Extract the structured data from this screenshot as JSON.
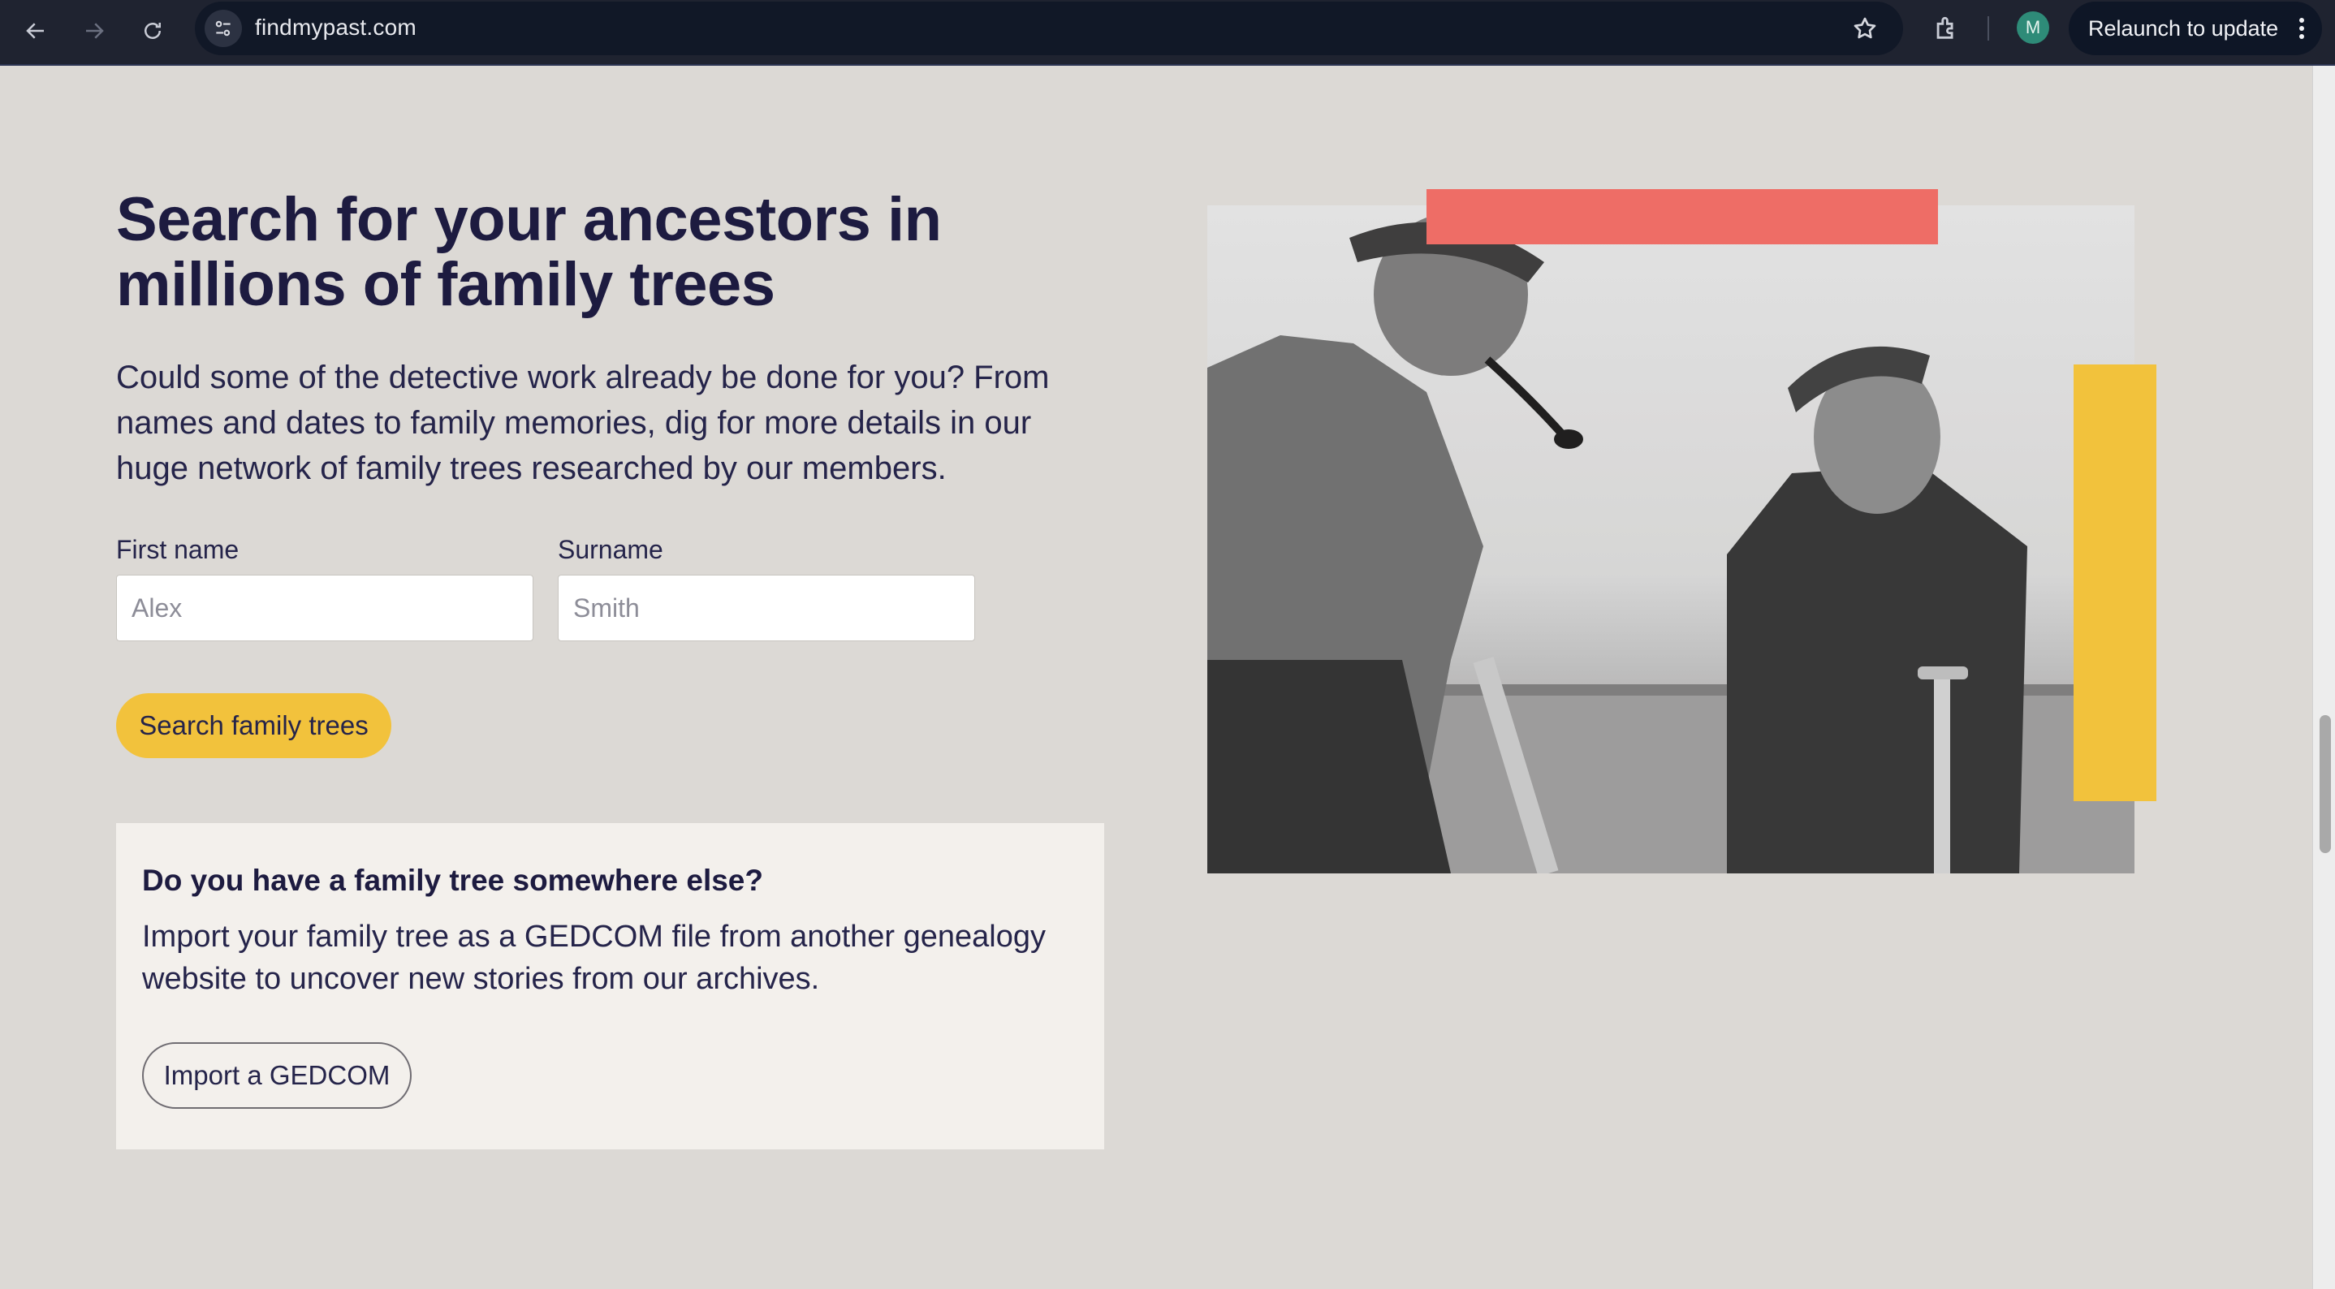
{
  "browser": {
    "url": "findmypast.com",
    "profile_initial": "M",
    "relaunch_label": "Relaunch to update"
  },
  "hero": {
    "title_line1": "Search for your ancestors in",
    "title_line2": "millions of family trees",
    "intro_line1": "Could some of the detective work already be done for you? From",
    "intro_line2": "names and dates to family memories, dig for more details in our",
    "intro_line3": "huge network of family trees researched by our members."
  },
  "search_form": {
    "first_name_label": "First name",
    "first_name_placeholder": "Alex",
    "first_name_value": "",
    "surname_label": "Surname",
    "surname_placeholder": "Smith",
    "surname_value": "",
    "submit_label": "Search family trees"
  },
  "import_card": {
    "title": "Do you have a family tree somewhere else?",
    "text_line1": "Import your family tree as a GEDCOM file from another genealogy",
    "text_line2": "website to uncover new stories from our archives.",
    "button_label": "Import a GEDCOM"
  },
  "colors": {
    "heading": "#1d1b40",
    "page_background": "#dcd9d5",
    "accent_yellow": "#f2c23c",
    "accent_red": "#ee6d66",
    "card_background": "#f3f0ec"
  },
  "icons": [
    "back-arrow-icon",
    "forward-arrow-icon",
    "reload-icon",
    "site-settings-icon",
    "bookmark-star-icon",
    "extensions-icon",
    "more-vert-icon"
  ]
}
